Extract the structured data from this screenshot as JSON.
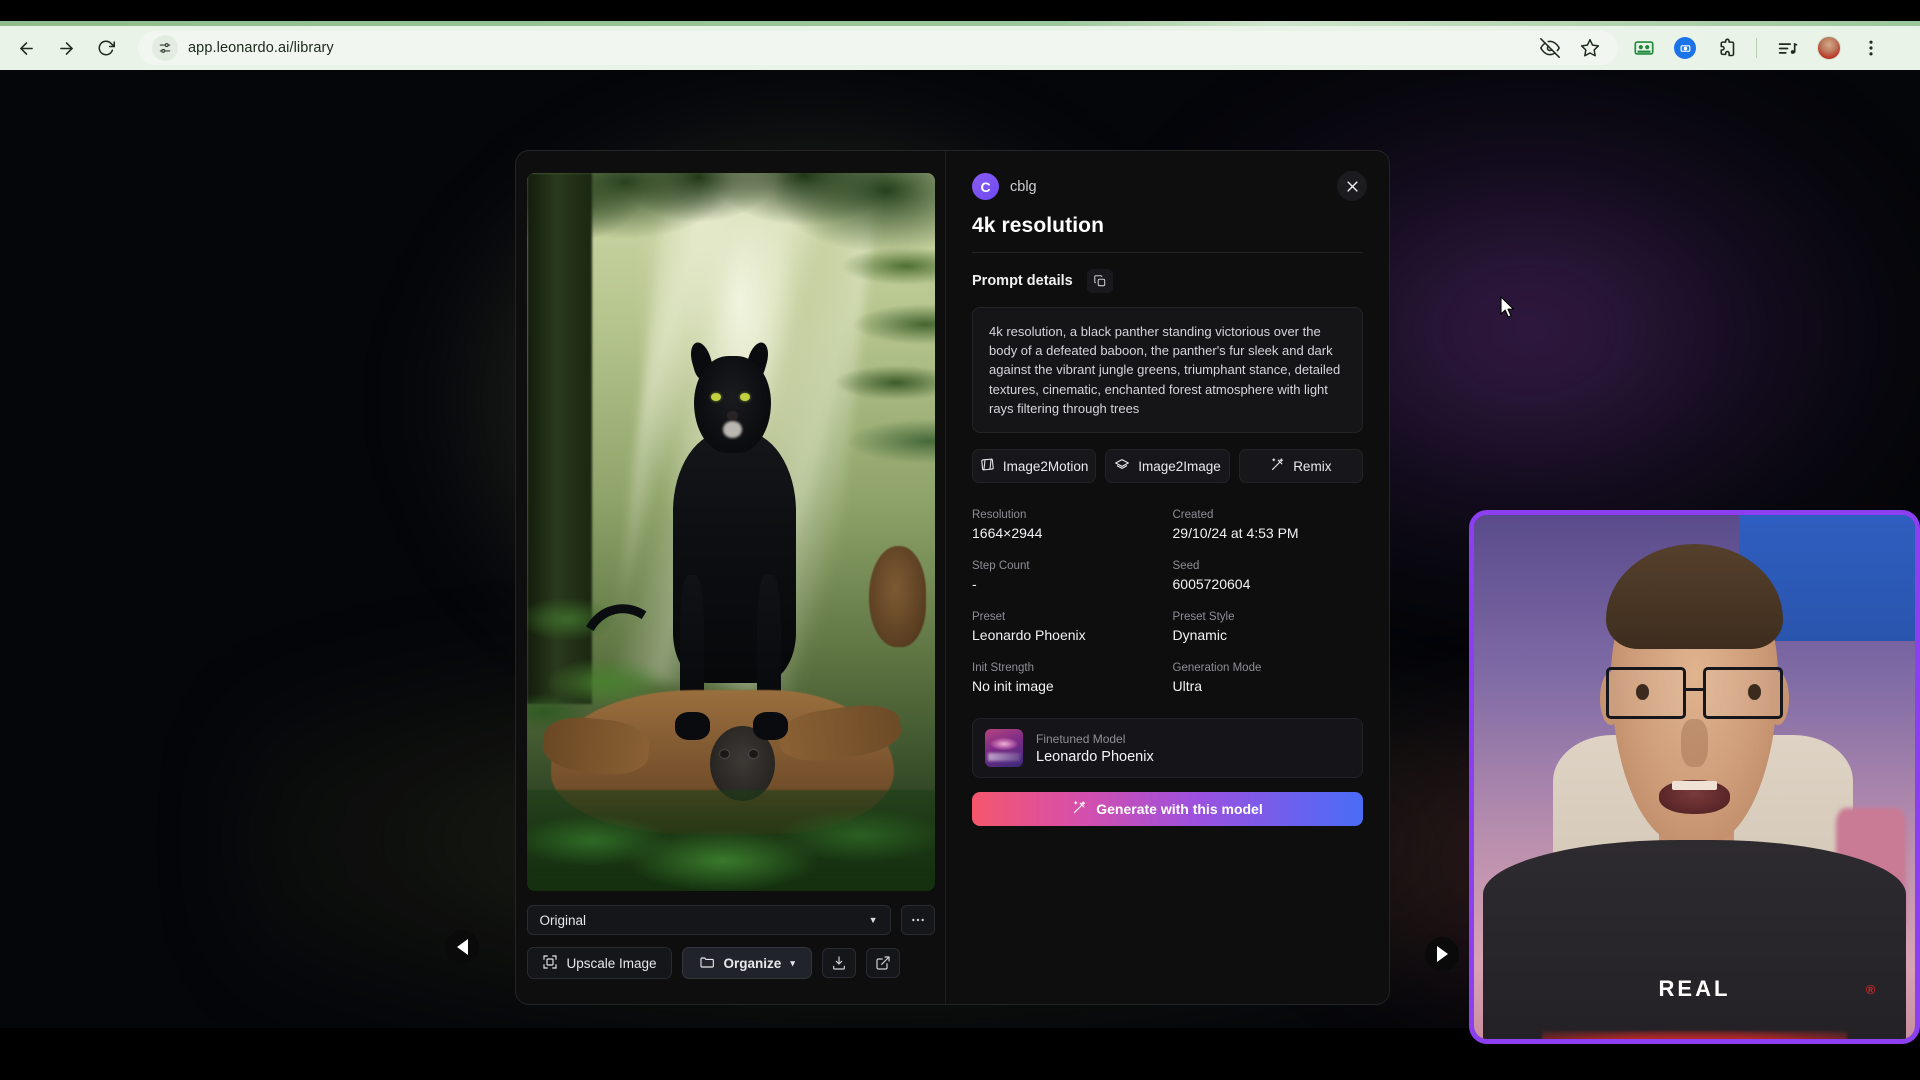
{
  "browser": {
    "url": "app.leonardo.ai/library",
    "nav": {
      "back": "back-arrow",
      "forward": "forward-arrow",
      "reload": "reload"
    },
    "omnibox_icon": "site-settings-icon",
    "toolbar_icons": [
      "eye-slash-icon",
      "bookmark-star-icon",
      "green-card-icon",
      "blue-circle-icon",
      "extensions-icon",
      "media-list-icon",
      "profile-avatar",
      "three-dot-menu-icon"
    ]
  },
  "modal": {
    "owner": {
      "initial": "C",
      "name": "cblg"
    },
    "title": "4k resolution",
    "close_label": "✕",
    "prompt": {
      "section_label": "Prompt details",
      "copy_icon": "copy-icon",
      "text": "4k resolution, a black panther standing victorious over the body of a defeated baboon, the panther's fur sleek and dark against the vibrant jungle greens, triumphant stance, detailed textures, cinematic, enchanted forest atmosphere with light rays filtering through trees"
    },
    "actions": [
      {
        "label": "Image2Motion",
        "icon": "film-motion-icon"
      },
      {
        "label": "Image2Image",
        "icon": "layers-icon"
      },
      {
        "label": "Remix",
        "icon": "wand-sparkle-icon"
      }
    ],
    "meta": [
      {
        "label": "Resolution",
        "value": "1664×2944"
      },
      {
        "label": "Created",
        "value": "29/10/24 at 4:53 PM"
      },
      {
        "label": "Step Count",
        "value": "-"
      },
      {
        "label": "Seed",
        "value": "6005720604"
      },
      {
        "label": "Preset",
        "value": "Leonardo Phoenix"
      },
      {
        "label": "Preset Style",
        "value": "Dynamic"
      },
      {
        "label": "Init Strength",
        "value": "No init image"
      },
      {
        "label": "Generation Mode",
        "value": "Ultra"
      }
    ],
    "model": {
      "label": "Finetuned Model",
      "name": "Leonardo Phoenix",
      "thumb_icon": "leonardo-phoenix-thumbnail"
    },
    "generate": {
      "label": "Generate with this model",
      "icon": "wand-sparkle-icon",
      "gradient_from": "#f5576c",
      "gradient_to": "#4a6cf7"
    },
    "image_controls": {
      "variant_select": {
        "value": "Original",
        "caret": "▼"
      },
      "more_button": "…",
      "upscale": {
        "label": "Upscale Image",
        "icon": "upscale-icon"
      },
      "organize": {
        "label": "Organize",
        "icon": "folder-icon",
        "caret": "▾"
      },
      "download_icon": "download-icon",
      "share_icon": "share-external-icon"
    },
    "artwork_alt": "black panther standing over a defeated baboon in a sunlit jungle"
  },
  "navigation": {
    "prev_label": "◀",
    "next_label": "▶"
  },
  "webcam": {
    "border_color": "#8b3ff0",
    "shirt_text": "REAL",
    "registered_mark": "®"
  },
  "colors": {
    "browser_toolbar": "#eaf3e8",
    "accent_purple": "#8b3ff0",
    "avatar_purple": "#7c5cf6",
    "modal_bg": "#0e0e0f"
  }
}
